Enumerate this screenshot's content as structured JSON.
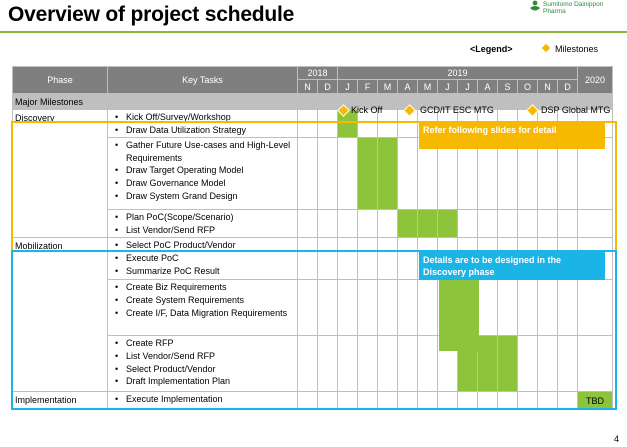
{
  "title": "Overview of project schedule",
  "logo": {
    "line1": "Sumitomo Dainippon",
    "line2": "Pharma"
  },
  "legend": {
    "label": "<Legend>",
    "milestone": "Milestones"
  },
  "header": {
    "phase": "Phase",
    "key_tasks": "Key Tasks",
    "years": [
      "2018",
      "2019",
      "2020"
    ],
    "months": [
      "N",
      "D",
      "J",
      "F",
      "M",
      "A",
      "M",
      "J",
      "J",
      "A",
      "S",
      "O",
      "N",
      "D"
    ]
  },
  "major_milestones": {
    "label": "Major Milestones",
    "items": [
      "Kick Off",
      "GCD/IT ESC MTG",
      "DSP Global MTG"
    ]
  },
  "phases": [
    {
      "name": "Discovery",
      "groups": [
        [
          "Kick Off/Survey/Workshop",
          "Draw Data Utilization Strategy"
        ],
        [
          "Gather Future Use-cases and High-Level Requirements",
          "Draw Target Operating Model",
          "Draw Governance Model",
          "Draw System Grand Design"
        ],
        [
          "Plan PoC(Scope/Scenario)",
          "List Vendor/Send RFP"
        ]
      ],
      "note": "Refer following slides for detail"
    },
    {
      "name": "Mobilization",
      "groups": [
        [
          "Select PoC Product/Vendor",
          "Execute PoC",
          "Summarize PoC Result"
        ],
        [
          "Create Biz Requirements",
          "Create System Requirements",
          "Create I/F, Data Migration Requirements"
        ],
        [
          "Create RFP",
          "List Vendor/Send RFP",
          "Select Product/Vendor",
          "Draft Implementation Plan"
        ]
      ],
      "note": "Details are to be designed in the Discovery phase"
    },
    {
      "name": "Implementation",
      "groups": [
        [
          "Execute Implementation"
        ]
      ],
      "tbd": "TBD"
    }
  ],
  "colors": {
    "bar": "#8dc43c",
    "discovery": "#f6b900",
    "mobilization": "#1ab5e6",
    "header": "#7f7f7f"
  },
  "page_number": "4"
}
